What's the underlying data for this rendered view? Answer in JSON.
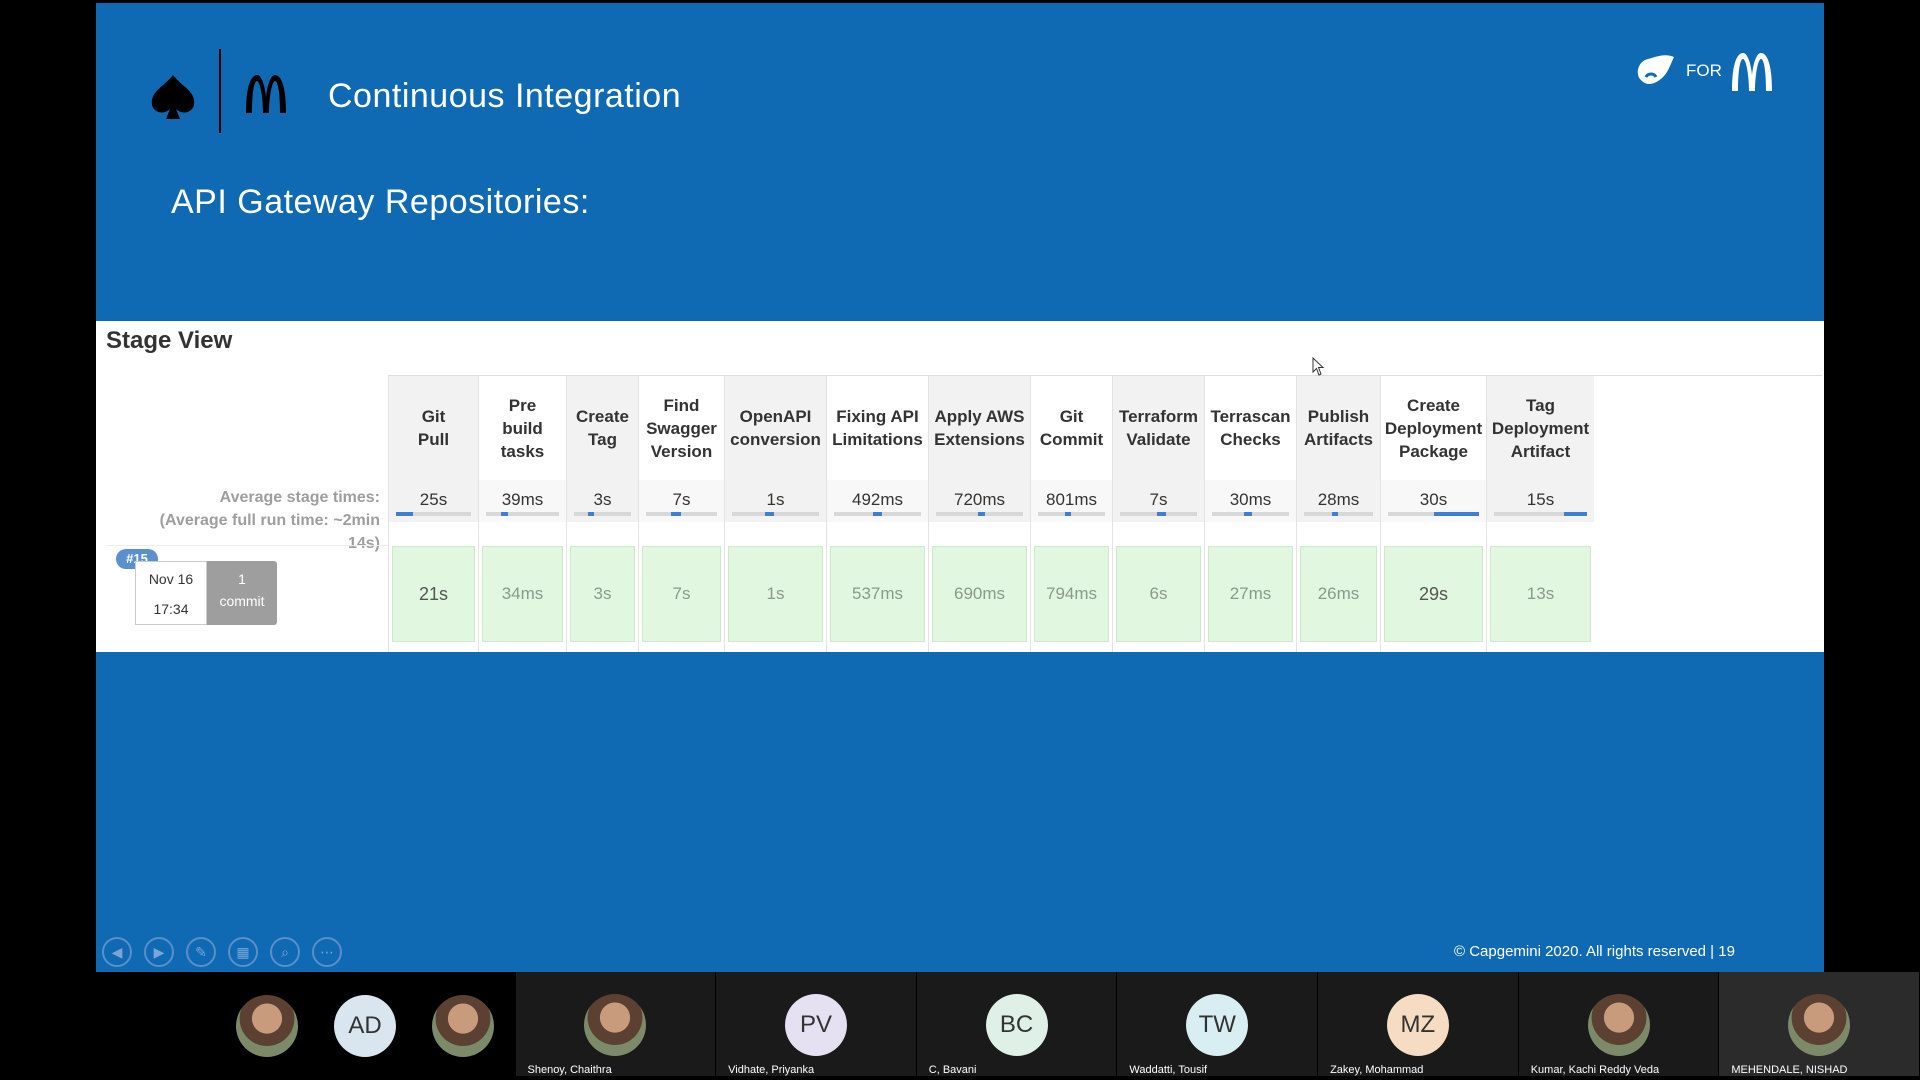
{
  "slide": {
    "title": "Continuous Integration",
    "subtitle": "API Gateway Repositories:",
    "brand_for": "FOR",
    "copyright": "© Capgemini 2020. All rights reserved   |    19"
  },
  "stage_view": {
    "title": "Stage View",
    "avg_label_line1": "Average stage times:",
    "avg_label_line2": "(Average full run time: ~2min",
    "avg_label_line3": "14s)",
    "run": {
      "badge": "#15",
      "date": "Nov 16",
      "time": "17:34",
      "commit_count": "1",
      "commit_label": "commit"
    },
    "stages": [
      {
        "name": "Git\nPull",
        "avg": "25s",
        "run": "21s"
      },
      {
        "name": "Pre\nbuild\ntasks",
        "avg": "39ms",
        "run": "34ms"
      },
      {
        "name": "Create\nTag",
        "avg": "3s",
        "run": "3s"
      },
      {
        "name": "Find\nSwagger\nVersion",
        "avg": "7s",
        "run": "7s"
      },
      {
        "name": "OpenAPI\nconversion",
        "avg": "1s",
        "run": "1s"
      },
      {
        "name": "Fixing API\nLimitations",
        "avg": "492ms",
        "run": "537ms"
      },
      {
        "name": "Apply AWS\nExtensions",
        "avg": "720ms",
        "run": "690ms"
      },
      {
        "name": "Git\nCommit",
        "avg": "801ms",
        "run": "794ms"
      },
      {
        "name": "Terraform\nValidate",
        "avg": "7s",
        "run": "6s"
      },
      {
        "name": "Terrascan\nChecks",
        "avg": "30ms",
        "run": "27ms"
      },
      {
        "name": "Publish\nArtifacts",
        "avg": "28ms",
        "run": "26ms"
      },
      {
        "name": "Create\nDeployment\nPackage",
        "avg": "30s",
        "run": "29s"
      },
      {
        "name": "Tag\nDeployment\nArtifact",
        "avg": "15s",
        "run": "13s"
      }
    ]
  },
  "participants": {
    "mini": [
      {
        "initials": "",
        "color": "#c9a27f"
      },
      {
        "initials": "AD",
        "color": "#d9e6ef"
      },
      {
        "initials": "",
        "color": "#8d6e55"
      }
    ],
    "tiles": [
      {
        "name": "Shenoy, Chaithra",
        "initials": "",
        "color": "#7b8f6a"
      },
      {
        "name": "Vidhate, Priyanka",
        "initials": "PV",
        "color": "#e6e0f3"
      },
      {
        "name": "C, Bavani",
        "initials": "BC",
        "color": "#dff0e6"
      },
      {
        "name": "Waddatti, Tousif",
        "initials": "TW",
        "color": "#d8eef3"
      },
      {
        "name": "Zakey, Mohammad",
        "initials": "MZ",
        "color": "#f5dcc3"
      },
      {
        "name": "Kumar, Kachi Reddy Veda",
        "initials": "",
        "color": "#8b6c4f"
      },
      {
        "name": "MEHENDALE, NISHAD",
        "initials": "",
        "color": "#9c5a3c"
      }
    ]
  }
}
